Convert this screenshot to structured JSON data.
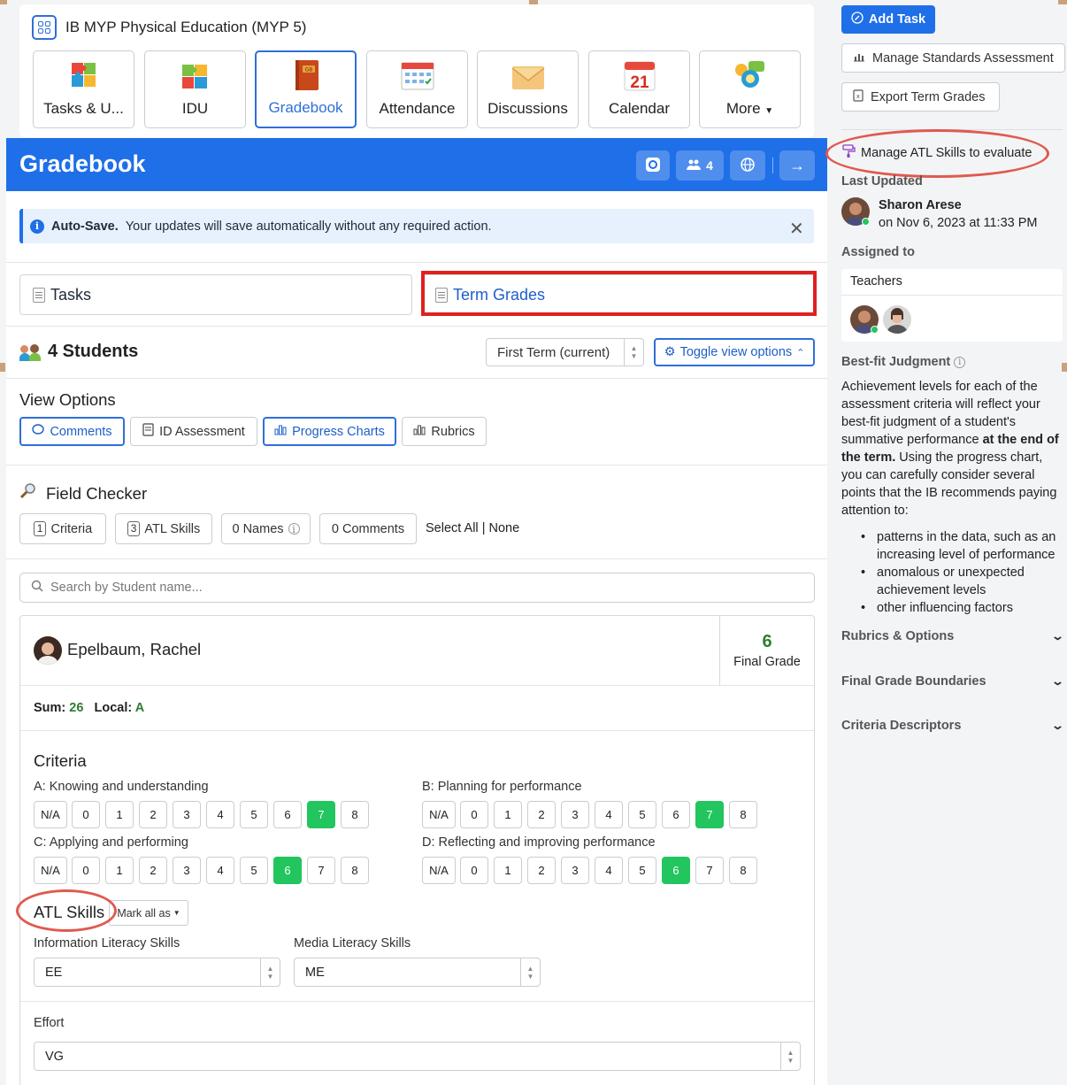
{
  "course": {
    "title": "IB MYP Physical Education (MYP 5)",
    "apps": [
      {
        "label": "Tasks & U..."
      },
      {
        "label": "IDU"
      },
      {
        "label": "Gradebook"
      },
      {
        "label": "Attendance"
      },
      {
        "label": "Discussions"
      },
      {
        "label": "Calendar",
        "day": "21"
      },
      {
        "label": "More"
      }
    ]
  },
  "gradebook": {
    "title": "Gradebook",
    "people_count": "4",
    "autosave_bold": "Auto-Save.",
    "autosave_text": "Your updates will save automatically without any required action.",
    "tabs": {
      "tasks": "Tasks",
      "term_grades": "Term Grades"
    },
    "students_title": "4 Students",
    "term_select": "First Term (current)",
    "toggle_view": "Toggle view options",
    "view_options_title": "View Options",
    "view_options": {
      "comments": "Comments",
      "id_assessment": "ID Assessment",
      "progress_charts": "Progress Charts",
      "rubrics": "Rubrics"
    },
    "field_checker_title": "Field Checker",
    "field_checker": {
      "criteria_count": "1",
      "criteria_label": "Criteria",
      "atl_count": "3",
      "atl_label": "ATL Skills",
      "names": "0 Names",
      "comments": "0 Comments",
      "select_all": "Select All",
      "sep": "|",
      "none": "None"
    },
    "search_placeholder": "Search by Student name..."
  },
  "student": {
    "name": "Epelbaum, Rachel",
    "final_grade": "6",
    "final_grade_label": "Final Grade",
    "sum_label": "Sum:",
    "sum_value": "26",
    "local_label": "Local:",
    "local_value": "A",
    "criteria_title": "Criteria",
    "grade_options": [
      "N/A",
      "0",
      "1",
      "2",
      "3",
      "4",
      "5",
      "6",
      "7",
      "8"
    ],
    "criteria": [
      {
        "label": "A: Knowing and understanding",
        "selected": "7"
      },
      {
        "label": "B: Planning for performance",
        "selected": "7"
      },
      {
        "label": "C: Applying and performing",
        "selected": "6"
      },
      {
        "label": "D: Reflecting and improving performance",
        "selected": "6"
      }
    ],
    "atl_title": "ATL Skills",
    "mark_all": "Mark all as",
    "atl_skills": [
      {
        "label": "Information Literacy Skills",
        "value": "EE"
      },
      {
        "label": "Media Literacy Skills",
        "value": "ME"
      }
    ],
    "effort_label": "Effort",
    "effort_value": "VG"
  },
  "sidebar": {
    "add_task": "Add Task",
    "manage_standards": "Manage Standards Assessment",
    "export_term_grades": "Export Term Grades",
    "manage_atl": "Manage ATL Skills to evaluate",
    "last_updated_label": "Last Updated",
    "updater_name": "Sharon Arese",
    "updated_on": "on Nov 6, 2023 at 11:33 PM",
    "assigned_to_label": "Assigned to",
    "teachers_label": "Teachers",
    "bestfit_title": "Best-fit Judgment",
    "bestfit_p1": "Achievement levels for each of the assessment criteria will reflect your best-fit judgment of a student's summative performance ",
    "bestfit_bold": "at the end of the term.",
    "bestfit_p2": " Using the progress chart, you can carefully consider several points that the IB recommends paying attention to:",
    "bestfit_points": [
      "patterns in the data, such as an increasing level of performance",
      "anomalous or unexpected achievement levels",
      "other influencing factors"
    ],
    "accordions": [
      "Rubrics & Options",
      "Final Grade Boundaries",
      "Criteria Descriptors"
    ]
  },
  "colors": {
    "primary": "#1e6fe8",
    "selected_grade": "#22c55e",
    "annotation_red": "#e02020"
  }
}
